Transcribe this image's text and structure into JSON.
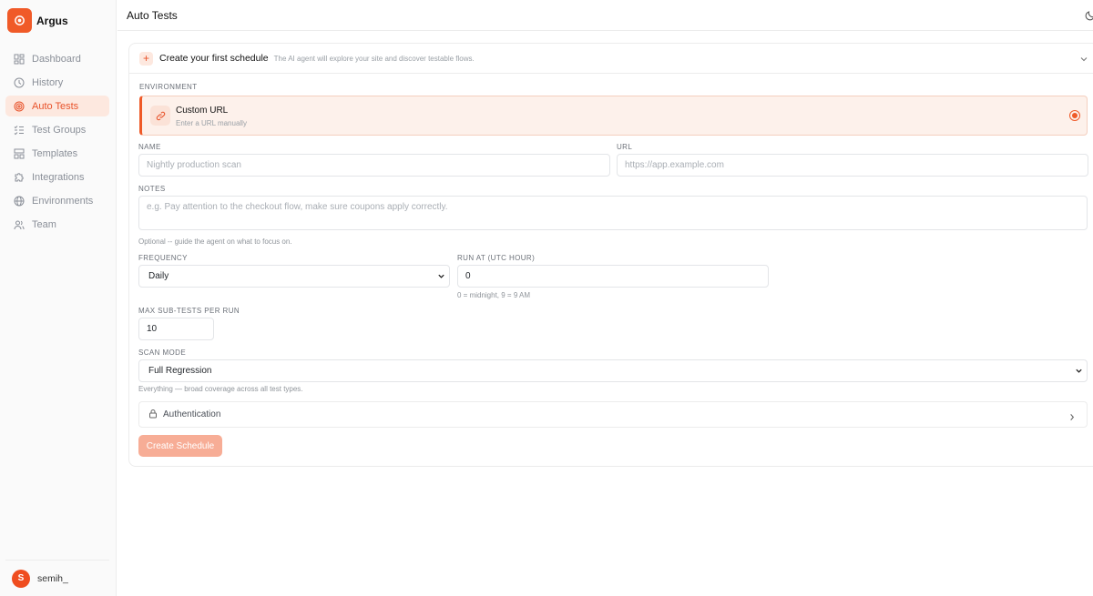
{
  "app": {
    "name": "Argus"
  },
  "sidebar": {
    "items": [
      {
        "label": "Dashboard",
        "icon": "grid-icon",
        "active": false
      },
      {
        "label": "History",
        "icon": "clock-icon",
        "active": false
      },
      {
        "label": "Auto Tests",
        "icon": "target-icon",
        "active": true
      },
      {
        "label": "Test Groups",
        "icon": "list-check-icon",
        "active": false
      },
      {
        "label": "Templates",
        "icon": "layout-icon",
        "active": false
      },
      {
        "label": "Integrations",
        "icon": "puzzle-icon",
        "active": false
      },
      {
        "label": "Environments",
        "icon": "globe-icon",
        "active": false
      },
      {
        "label": "Team",
        "icon": "users-icon",
        "active": false
      }
    ],
    "user": {
      "initial": "S",
      "name": "semih_"
    }
  },
  "header": {
    "title": "Auto Tests",
    "theme_icon": "moon-icon"
  },
  "schedule": {
    "title": "Create your first schedule",
    "subtitle": "The AI agent will explore your site and discover testable flows.",
    "environment_label": "ENVIRONMENT",
    "environment_option": {
      "title": "Custom URL",
      "subtitle": "Enter a URL manually",
      "selected": true
    },
    "name_label": "NAME",
    "name_placeholder": "Nightly production scan",
    "url_label": "URL",
    "url_placeholder": "https://app.example.com",
    "notes_label": "NOTES",
    "notes_placeholder": "e.g. Pay attention to the checkout flow, make sure coupons apply correctly.",
    "notes_hint": "Optional -- guide the agent on what to focus on.",
    "frequency_label": "FREQUENCY",
    "frequency_value": "Daily",
    "run_at_label": "RUN AT (UTC HOUR)",
    "run_at_value": "0",
    "run_at_hint": "0 = midnight, 9 = 9 AM",
    "max_subtests_label": "MAX SUB-TESTS PER RUN",
    "max_subtests_value": "10",
    "scan_mode_label": "SCAN MODE",
    "scan_mode_value": "Full Regression",
    "scan_mode_hint": "Everything — broad coverage across all test types.",
    "auth_label": "Authentication",
    "submit_label": "Create Schedule"
  },
  "colors": {
    "accent": "#ef5a28",
    "accent_soft": "#fde8df",
    "button_disabled": "#f7ad96"
  }
}
